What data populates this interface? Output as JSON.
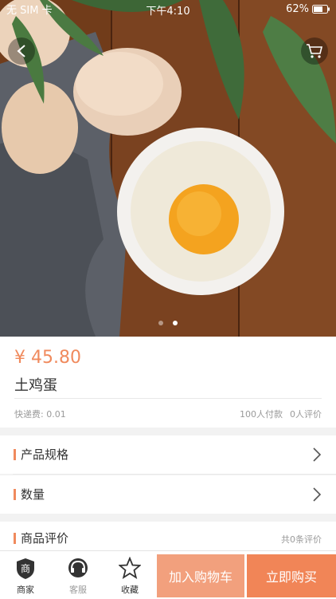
{
  "status_bar": {
    "carrier": "无 SIM 卡",
    "time": "下午4:10",
    "battery": "62%"
  },
  "carousel": {
    "total": 2,
    "active_index": 1
  },
  "product": {
    "price": "¥ 45.80",
    "title": "土鸡蛋",
    "shipping": "快递费: 0.01",
    "buyers": "100人付款",
    "reviews": "0人评价"
  },
  "rows": {
    "spec_label": "产品规格",
    "qty_label": "数量",
    "review_label": "商品评价",
    "review_count": "共0条评价"
  },
  "tabbar": {
    "shop": "商家",
    "service": "客服",
    "favorite": "收藏",
    "shop_badge": "商",
    "add_cart": "加入购物车",
    "buy_now": "立即购买"
  },
  "colors": {
    "accent": "#f08a5d",
    "cart_btn": "#f2a07d",
    "buy_btn": "#f18557"
  }
}
